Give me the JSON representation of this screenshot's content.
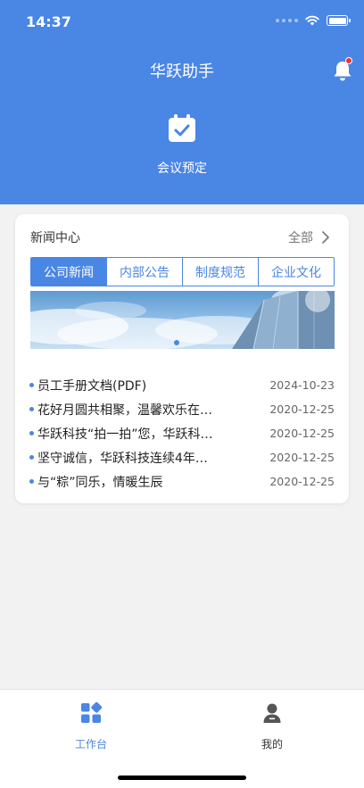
{
  "status_bar": {
    "time": "14:37"
  },
  "header": {
    "app_title": "华跃助手",
    "meeting_label": "会议预定",
    "notification_icon": "bell-icon",
    "meeting_icon": "calendar-check-icon"
  },
  "news": {
    "title": "新闻中心",
    "more_label": "全部",
    "tabs": [
      {
        "label": "公司新闻",
        "active": true
      },
      {
        "label": "内部公告",
        "active": false
      },
      {
        "label": "制度规范",
        "active": false
      },
      {
        "label": "企业文化",
        "active": false
      }
    ],
    "items": [
      {
        "title": "员工手册文档(PDF)",
        "date": "2024-10-23"
      },
      {
        "title": "花好月圆共相聚，温馨欢乐在…",
        "date": "2020-12-25"
      },
      {
        "title": "华跃科技“拍一拍”您，华跃科…",
        "date": "2020-12-25"
      },
      {
        "title": "坚守诚信，华跃科技连续4年…",
        "date": "2020-12-25"
      },
      {
        "title": "与“粽”同乐，情暖生辰",
        "date": "2020-12-25"
      }
    ]
  },
  "tabbar": {
    "work_label": "工作台",
    "mine_label": "我的"
  },
  "colors": {
    "accent": "#4a86e4",
    "badge": "#e53935"
  }
}
